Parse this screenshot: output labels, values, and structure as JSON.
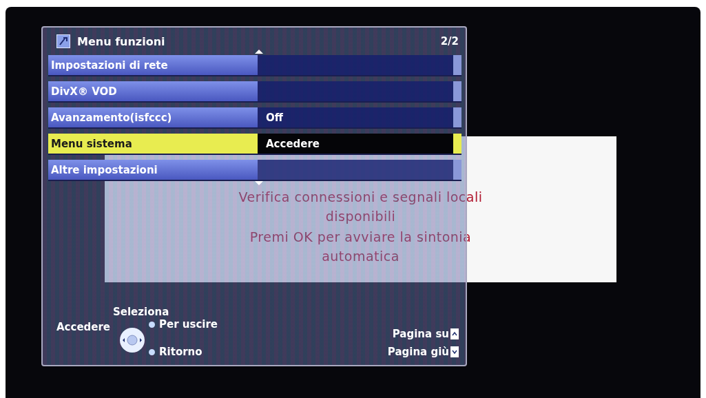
{
  "dialog": {
    "messages": [
      "Verifica connessioni e segnali locali disponibili",
      "Premi OK per avviare la sintonia automatica"
    ]
  },
  "menu": {
    "title": "Menu funzioni",
    "page": "2/2",
    "rows": [
      {
        "label": "Impostazioni di rete",
        "value": "",
        "selected": false
      },
      {
        "label": "DivX® VOD",
        "value": "",
        "selected": false
      },
      {
        "label": "Avanzamento(isfccc)",
        "value": "Off",
        "selected": false
      },
      {
        "label": "Menu sistema",
        "value": "Accedere",
        "selected": true
      },
      {
        "label": "Altre impostazioni",
        "value": "",
        "selected": false
      }
    ]
  },
  "help": {
    "select": "Seleziona",
    "enter": "Accedere",
    "exit": "Per uscire",
    "back": "Ritorno",
    "page_up": "Pagina su",
    "page_down": "Pagina giù"
  }
}
